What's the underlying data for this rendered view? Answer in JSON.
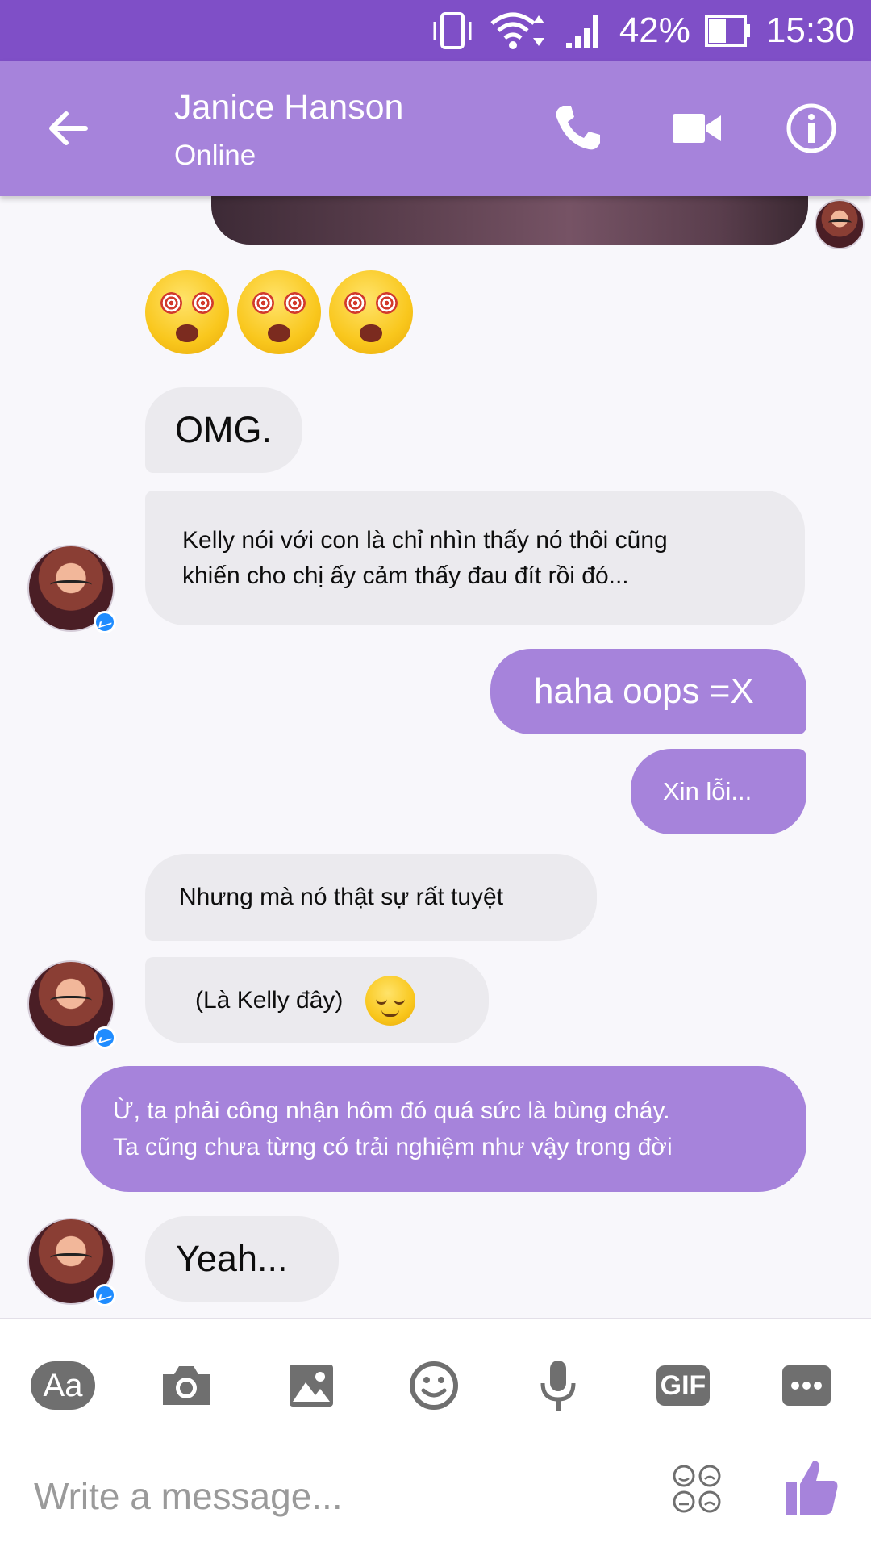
{
  "status_bar": {
    "battery_pct": "42%",
    "time": "15:30"
  },
  "header": {
    "contact_name": "Janice Hanson",
    "contact_status": "Online"
  },
  "messages": [
    {
      "dir": "in",
      "text": "OMG."
    },
    {
      "dir": "in",
      "text": "Kelly nói với con là chỉ nhìn thấy nó thôi cũng\nkhiến cho chị ấy cảm thấy đau đít rồi đó..."
    },
    {
      "dir": "out",
      "text": "haha oops =X"
    },
    {
      "dir": "out",
      "text": "Xin lỗi..."
    },
    {
      "dir": "in",
      "text": "Nhưng mà nó thật sự rất tuyệt"
    },
    {
      "dir": "in",
      "text": "(Là Kelly đây)"
    },
    {
      "dir": "out",
      "text": "Ừ, ta phải công nhận hôm đó quá sức là bùng cháy.\nTa cũng chưa từng có trải nghiệm như vậy trong đời"
    },
    {
      "dir": "in",
      "text": "Yeah..."
    }
  ],
  "composer": {
    "aa_label": "Aa",
    "gif_label": "GIF",
    "placeholder": "Write a message..."
  },
  "colors": {
    "status_bar": "#7f4fc7",
    "header": "#a683db",
    "bubble_in": "#ebeaee",
    "bubble_out": "#a683db"
  },
  "icons": [
    "back-arrow-icon",
    "phone-icon",
    "video-camera-icon",
    "info-icon",
    "camera-icon",
    "image-icon",
    "emoji-icon",
    "microphone-icon",
    "gif-icon",
    "more-icon",
    "sticker-icon",
    "thumbs-up-icon"
  ]
}
